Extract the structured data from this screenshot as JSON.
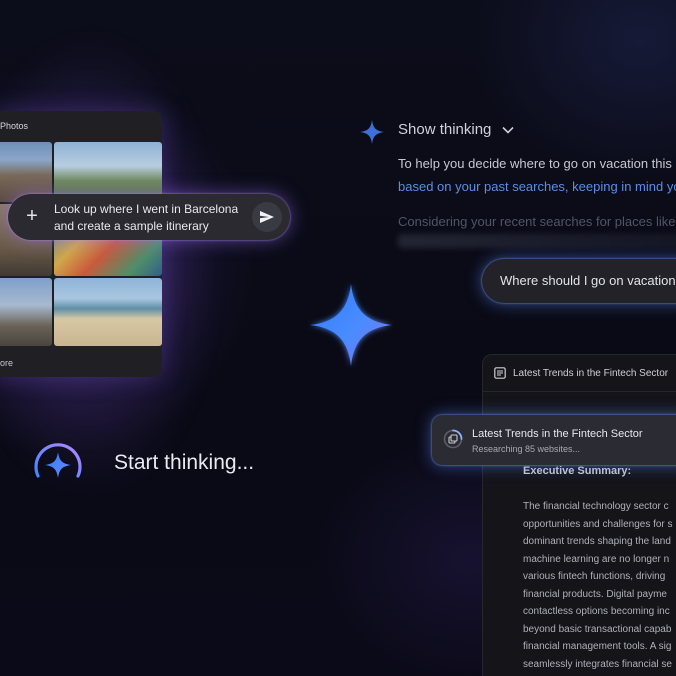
{
  "colors": {
    "accent_blue": "#4a8cff",
    "accent_purple": "#9b6bff",
    "link_blue": "#5a8ee6"
  },
  "photos_panel": {
    "title": "Photos",
    "more_label": "ore"
  },
  "prompt_left": {
    "plus_icon": "plus-icon",
    "line1": "Look up where I went in Barcelona",
    "line2": "and create a sample itinerary",
    "send_icon": "send-icon"
  },
  "start": {
    "label": "Start thinking..."
  },
  "thinking": {
    "toggle_label": "Show thinking",
    "line1": "To help you decide where to go on vacation this",
    "line2": "based on your past searches, keeping in mind yo",
    "line3": "Considering your recent searches for places like"
  },
  "prompt_right": {
    "text": "Where should I go on vacation th"
  },
  "document": {
    "title": "Latest Trends in the Fintech Sector",
    "heading": "Executive Summary:",
    "lines": [
      "The financial technology sector c",
      "opportunities and challenges for s",
      "dominant trends shaping the land",
      "machine learning are no longer n",
      "various fintech functions, driving",
      "financial products. Digital payme",
      "contactless options becoming inc",
      "beyond basic transactional capab",
      "financial management tools. A sig",
      "seamlessly integrates financial se"
    ]
  },
  "research_chip": {
    "title": "Latest Trends in the Fintech Sector",
    "subtitle": "Researching 85 websites..."
  }
}
